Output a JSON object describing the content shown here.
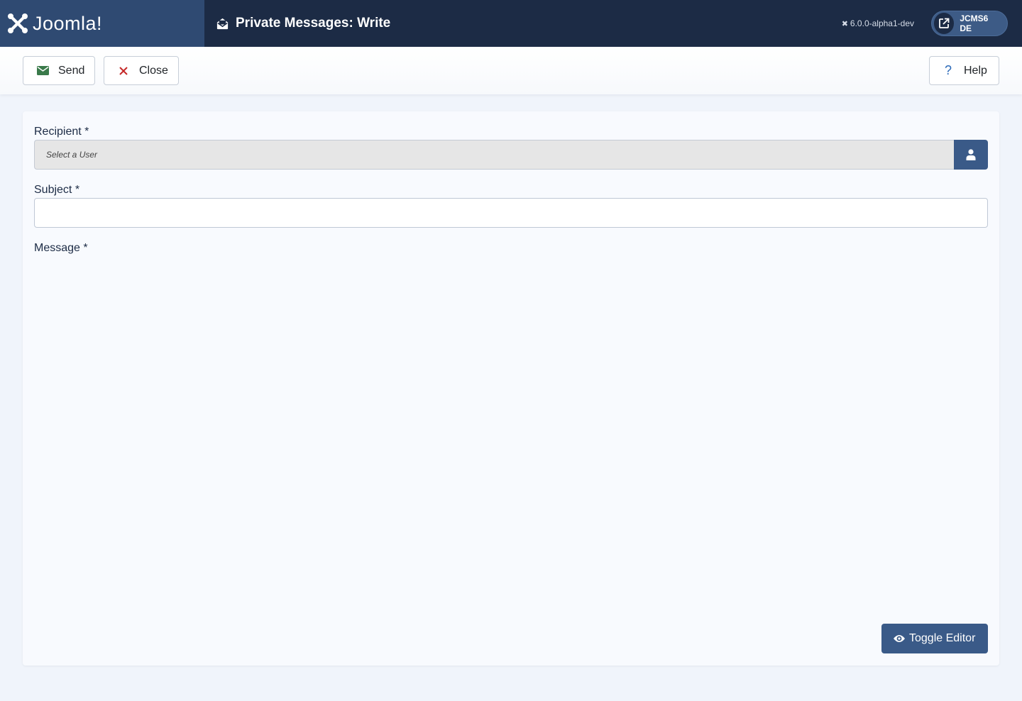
{
  "header": {
    "brand": "Joomla!",
    "page_title": "Private Messages: Write",
    "version": "6.0.0-alpha1-dev",
    "site_button": "JCMS6 DE",
    "icons": {
      "brand": "joomla-logo-icon",
      "page": "envelope-open-icon",
      "version": "joomla-small-icon",
      "site": "external-link-icon"
    }
  },
  "toolbar": {
    "send_label": "Send",
    "close_label": "Close",
    "help_label": "Help",
    "icons": {
      "send": "envelope-icon",
      "close": "close-x-icon",
      "help": "question-icon"
    }
  },
  "form": {
    "recipient_label": "Recipient *",
    "recipient_placeholder": "Select a User",
    "subject_label": "Subject *",
    "subject_value": "",
    "message_label": "Message *",
    "toggle_editor_label": "Toggle Editor"
  },
  "colors": {
    "header_bg": "#1c2b45",
    "brand_bg": "#2f4a72",
    "primary": "#3a5a88",
    "send_icon": "#3a7a4a",
    "close_icon": "#c52827",
    "help_icon": "#2a69b8"
  }
}
